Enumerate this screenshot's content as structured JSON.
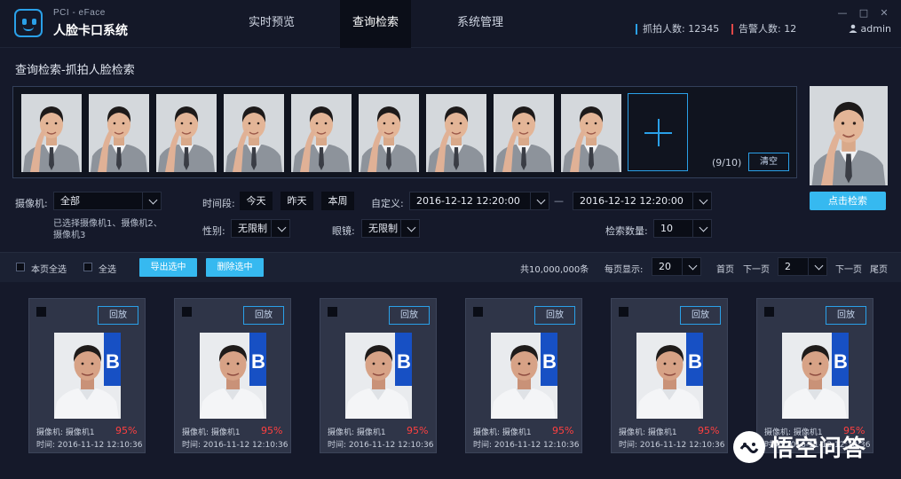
{
  "app": {
    "subtitle": "PCI - eFace",
    "name": "人脸卡口系统",
    "accent": "#2aa0e8",
    "primary_button_color": "#36b9f0",
    "alarm_color": "#e04848"
  },
  "nav": {
    "tabs": [
      {
        "label": "实时预览",
        "active": false
      },
      {
        "label": "查询检索",
        "active": true
      },
      {
        "label": "系统管理",
        "active": false
      }
    ]
  },
  "header_stats": {
    "capture": "抓拍人数: 12345",
    "alarm": "告警人数: 12"
  },
  "user": {
    "name": "admin",
    "icon": "user-icon"
  },
  "window_controls": {
    "minimize": "—",
    "maximize": "□",
    "close": "✕"
  },
  "page": {
    "title": "查询检索-抓拍人脸检索"
  },
  "query_strip": {
    "thumbnail_count": 9,
    "add_icon": "plus-icon",
    "count_label": "(9/10)",
    "clear_label": "清空"
  },
  "search": {
    "button_label": "点击检索"
  },
  "filters": {
    "camera": {
      "label": "摄像机:",
      "value": "全部"
    },
    "camera_note": "已选择摄像机1、摄像机2、摄像机3",
    "period": {
      "label": "时间段:",
      "options": [
        "今天",
        "昨天",
        "本周"
      ]
    },
    "custom": {
      "label": "自定义:",
      "start": "2016-12-12  12:20:00",
      "separator": "—",
      "end": "2016-12-12  12:20:00"
    },
    "gender": {
      "label": "性别:",
      "value": "无限制"
    },
    "glasses": {
      "label": "眼镜:",
      "value": "无限制"
    },
    "count": {
      "label": "检索数量:",
      "value": "10"
    }
  },
  "toolbar": {
    "select_page": "本页全选",
    "select_all": "全选",
    "export": "导出选中",
    "delete": "删除选中",
    "total": "共10,000,000条",
    "per_page_label": "每页显示:",
    "per_page": "20",
    "first": "首页",
    "prev": "下一页",
    "page": "2",
    "next": "下一页",
    "last": "尾页"
  },
  "results": [
    {
      "playback": "回放",
      "cam": "摄像机:  摄像机1",
      "score": "95%",
      "time": "时间:  2016-11-12  12:10:36"
    },
    {
      "playback": "回放",
      "cam": "摄像机:  摄像机1",
      "score": "95%",
      "time": "时间:  2016-11-12  12:10:36"
    },
    {
      "playback": "回放",
      "cam": "摄像机:  摄像机1",
      "score": "95%",
      "time": "时间:  2016-11-12  12:10:36"
    },
    {
      "playback": "回放",
      "cam": "摄像机:  摄像机1",
      "score": "95%",
      "time": "时间:  2016-11-12  12:10:36"
    },
    {
      "playback": "回放",
      "cam": "摄像机:  摄像机1",
      "score": "95%",
      "time": "时间:  2016-11-12  12:10:36"
    },
    {
      "playback": "回放",
      "cam": "摄像机:  摄像机1",
      "score": "95%",
      "time": "时间:  2016-11-12  12:10:36"
    }
  ],
  "watermark": {
    "text": "悟空问答"
  }
}
